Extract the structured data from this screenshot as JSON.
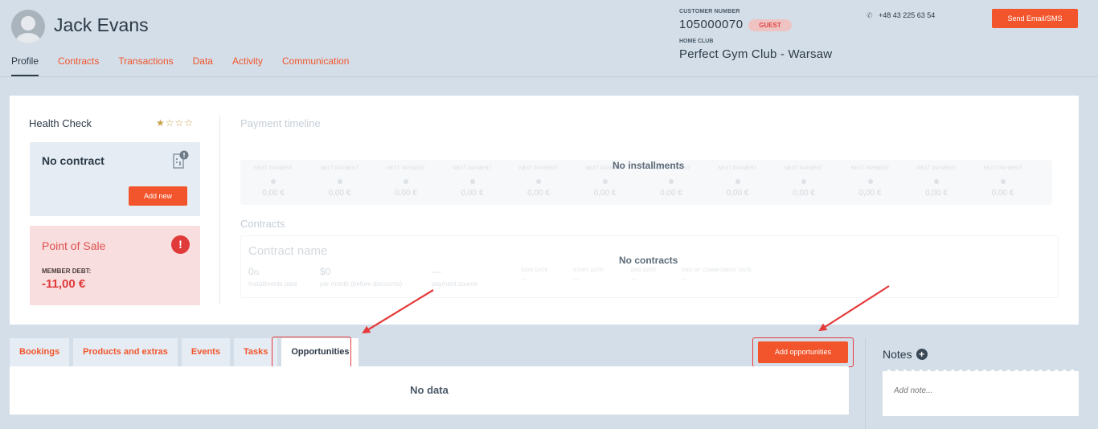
{
  "customer": {
    "name": "Jack Evans",
    "number_label": "CUSTOMER NUMBER",
    "number": "105000070",
    "badge": "GUEST",
    "home_club_label": "HOME CLUB",
    "home_club": "Perfect Gym Club - Warsaw",
    "phone": "+48 43 225 63 54",
    "send_button": "Send Email/SMS"
  },
  "nav": {
    "tabs": [
      "Profile",
      "Contracts",
      "Transactions",
      "Data",
      "Activity",
      "Communication"
    ],
    "active": "Profile"
  },
  "health_check": {
    "title": "Health Check",
    "stars": "★☆☆☆",
    "rating": 1,
    "contract": {
      "title": "No contract",
      "button": "Add new"
    },
    "pos": {
      "title": "Point of Sale",
      "debt_label": "MEMBER DEBT:",
      "debt_value": "-11,00 €"
    }
  },
  "payment_timeline": {
    "title": "Payment timeline",
    "column_label": "NEXT PAYMENT",
    "column_value": "0,00 €",
    "column_count": 12,
    "empty_message": "No installments"
  },
  "contracts": {
    "title": "Contracts",
    "name_placeholder": "Contract name",
    "installments_value": "0",
    "installments_suffix": "/0",
    "installments_label": "Installments paid",
    "amount_value": "$0",
    "amount_label": "per month (before discounts)",
    "source_value": "---",
    "source_label": "payment source",
    "sign_date": "SIGN DATE",
    "start_date": "START DATE",
    "end_date": "END DATE",
    "commitment_date": "END OF COMMITMENT DATE",
    "date_dash": "---",
    "empty_message": "No contracts"
  },
  "bottom_tabs": {
    "tabs": [
      "Bookings",
      "Products and extras",
      "Events",
      "Tasks",
      "Opportunities"
    ],
    "active": "Opportunities",
    "add_button": "Add opportunities",
    "empty_message": "No data"
  },
  "notes": {
    "title": "Notes",
    "placeholder": "Add note..."
  },
  "colors": {
    "accent": "#f2552c",
    "highlight": "#e53a3a",
    "background": "#d3dee8"
  }
}
